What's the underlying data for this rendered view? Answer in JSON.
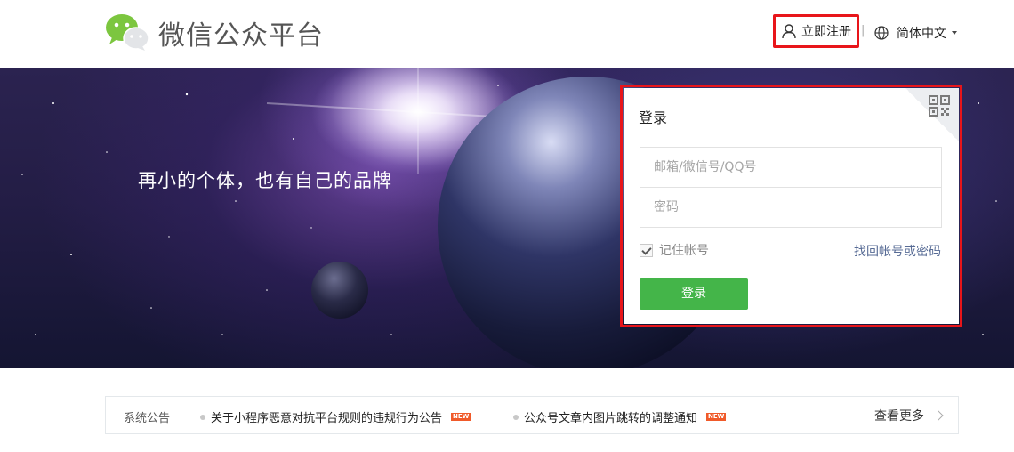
{
  "header": {
    "brand": "微信公众平台",
    "register_label": "立即注册",
    "separator": "|",
    "language_label": "简体中文"
  },
  "banner": {
    "slogan": "再小的个体，也有自己的品牌"
  },
  "login": {
    "title": "登录",
    "account_placeholder": "邮箱/微信号/QQ号",
    "password_placeholder": "密码",
    "remember_label": "记住帐号",
    "remember_checked": true,
    "forgot_label": "找回帐号或密码",
    "submit_label": "登录"
  },
  "notice": {
    "title": "系统公告",
    "items": [
      {
        "text": "关于小程序恶意对抗平台规则的违规行为公告",
        "badge": "NEW"
      },
      {
        "text": "公众号文章内图片跳转的调整通知",
        "badge": "NEW"
      }
    ],
    "more_label": "查看更多"
  },
  "icons": {
    "logo": "wechat-logo-icon",
    "register": "user-icon",
    "language": "globe-icon",
    "qr": "qr-code-icon",
    "more": "chevron-right-icon"
  },
  "colors": {
    "primary_green": "#44b549",
    "link_blue": "#576b95",
    "highlight_red": "#e8151a",
    "new_badge": "#f05a2a"
  }
}
